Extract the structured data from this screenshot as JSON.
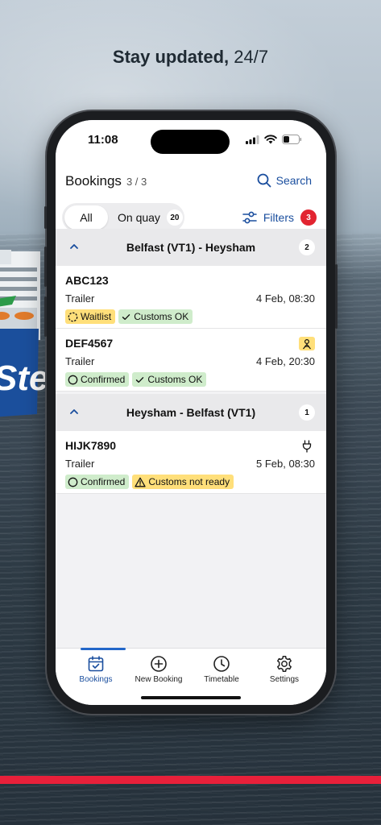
{
  "promo": {
    "headline_bold": "Stay updated,",
    "headline_rest": "24/7"
  },
  "status_bar": {
    "time": "11:08",
    "icons": [
      "signal-icon",
      "wifi-icon",
      "battery-icon"
    ]
  },
  "header": {
    "title": "Bookings",
    "count": "3 / 3",
    "search_label": "Search",
    "segments": {
      "all": "All",
      "on_quay": "On quay",
      "on_quay_count": "20"
    },
    "filters_label": "Filters",
    "filters_count": "3"
  },
  "groups": [
    {
      "route": "Belfast (VT1) - Heysham",
      "count": "2",
      "bookings": [
        {
          "ref": "ABC123",
          "type": "Trailer",
          "date": "4 Feb, 08:30",
          "tags": [
            {
              "label": "Waitlist",
              "color": "yellow",
              "icon": "dashed-circle-icon"
            },
            {
              "label": "Customs OK",
              "color": "green",
              "icon": "check-icon"
            }
          ]
        },
        {
          "ref": "DEF4567",
          "type": "Trailer",
          "date": "4 Feb, 20:30",
          "corner_icon": "hazard-person-icon",
          "tags": [
            {
              "label": "Confirmed",
              "color": "green",
              "icon": "circle-icon"
            },
            {
              "label": "Customs OK",
              "color": "green",
              "icon": "check-icon"
            }
          ]
        }
      ]
    },
    {
      "route": "Heysham - Belfast (VT1)",
      "count": "1",
      "bookings": [
        {
          "ref": "HIJK7890",
          "type": "Trailer",
          "date": "5 Feb, 08:30",
          "corner_icon": "plug-icon",
          "tags": [
            {
              "label": "Confirmed",
              "color": "green",
              "icon": "circle-icon"
            },
            {
              "label": "Customs not ready",
              "color": "yellow",
              "icon": "warning-icon"
            }
          ]
        }
      ]
    }
  ],
  "tabbar": {
    "bookings": "Bookings",
    "new_booking": "New Booking",
    "timetable": "Timetable",
    "settings": "Settings"
  },
  "colors": {
    "accent": "#1a4e9e",
    "badge_red": "#e22430",
    "brand_stripe": "#e8203a",
    "tag_yellow": "#ffdf7a",
    "tag_green": "#cfeccb"
  }
}
